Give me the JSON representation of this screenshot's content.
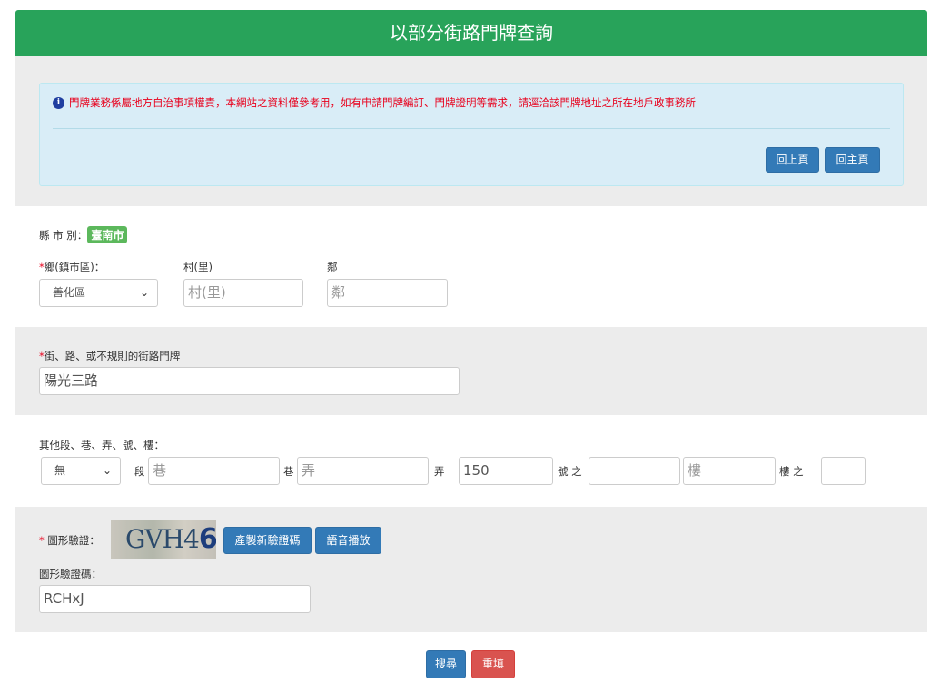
{
  "header": {
    "title": "以部分街路門牌查詢"
  },
  "notice": {
    "icon": "info-icon",
    "message": "門牌業務係屬地方自治事項權責，本網站之資料僅參考用，如有申請門牌編訂、門牌證明等需求，請逕洽該門牌地址之所在地戶政事務所",
    "back_label": "回上頁",
    "home_label": "回主頁"
  },
  "city": {
    "label": "縣 市 別：",
    "value": "臺南市",
    "district_label": "鄉(鎮市區)：",
    "district_value": "善化區",
    "village_label": "村(里)",
    "village_placeholder": "村(里)",
    "neighborhood_label": "鄰",
    "neighborhood_placeholder": "鄰"
  },
  "street": {
    "label": "街、路、或不規則的街路門牌",
    "value": "陽光三路"
  },
  "other": {
    "label": "其他段、巷、弄、號、樓：",
    "section_value": "無",
    "section_suffix": "段",
    "lane_placeholder": "巷",
    "lane_suffix": "巷",
    "alley_placeholder": "弄",
    "alley_suffix": "弄",
    "number_value": "150",
    "number_suffix": "號 之",
    "number_sub_value": "",
    "floor_placeholder": "樓",
    "floor_suffix": "樓 之",
    "floor_sub_value": ""
  },
  "captcha": {
    "label": "圖形驗證：",
    "image_text": "GVH4",
    "image_digit": "6",
    "generate_label": "產製新驗證碼",
    "audio_label": "語音播放",
    "code_label": "圖形驗證碼：",
    "code_value": "RCHxJ"
  },
  "actions": {
    "search_label": "搜尋",
    "reset_label": "重填"
  },
  "colors": {
    "header": "#28a35a",
    "primary_button": "#337ab7",
    "danger_button": "#d9534f",
    "alert_bg": "#d9edf7",
    "required": "#e8001c",
    "city_badge": "#5cb85c"
  }
}
